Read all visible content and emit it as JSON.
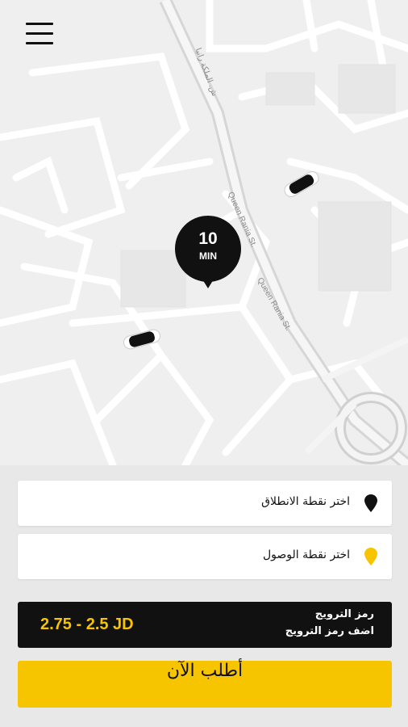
{
  "map": {
    "eta_value": "10",
    "eta_unit": "MIN",
    "street_labels": [
      "Queen Rania St.",
      "Queen Rania St.",
      "ش. الملكة رانيا"
    ]
  },
  "menu": {
    "icon": "hamburger-menu-icon"
  },
  "pickup": {
    "placeholder": "اختر نقطة الانطلاق",
    "icon": "black-pin-icon"
  },
  "dropoff": {
    "placeholder": "اختر نقطة الوصول",
    "icon": "yellow-pin-icon"
  },
  "promo": {
    "price_range": "2.75 - 2.5 JD",
    "title": "رمز الترويج",
    "subtitle": "اضف رمز الترويج"
  },
  "order_button": {
    "label": "أطلب الآن"
  },
  "colors": {
    "accent": "#f7c400",
    "dark": "#111111",
    "map_bg": "#efefef",
    "road": "#ffffff"
  }
}
